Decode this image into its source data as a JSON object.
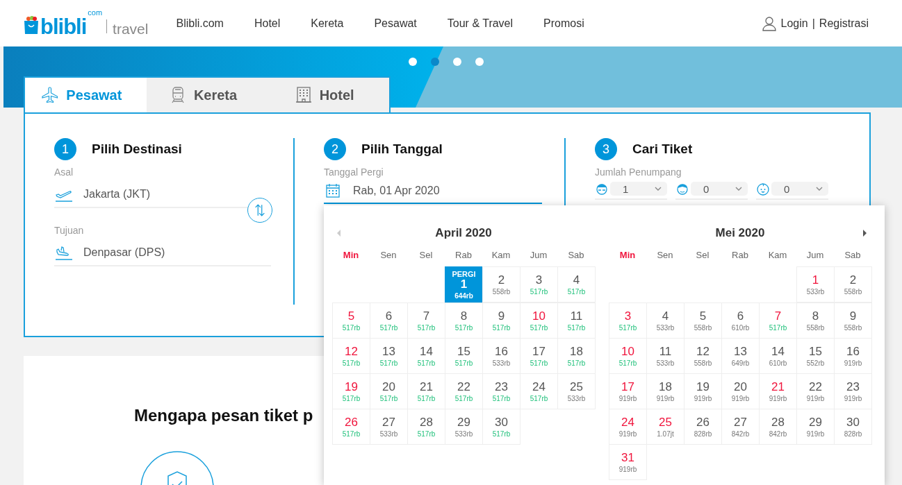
{
  "header": {
    "logo": {
      "name": "blibli",
      "suffix": "com",
      "product": "travel"
    },
    "nav": [
      {
        "label": "Blibli.com"
      },
      {
        "label": "Hotel"
      },
      {
        "label": "Kereta"
      },
      {
        "label": "Pesawat"
      },
      {
        "label": "Tour & Travel"
      },
      {
        "label": "Promosi"
      }
    ],
    "account": {
      "login": "Login",
      "separator": "|",
      "register": "Registrasi"
    }
  },
  "carousel": {
    "dots": [
      {
        "selected": false
      },
      {
        "selected": true
      },
      {
        "selected": false
      },
      {
        "selected": false
      }
    ]
  },
  "tabs": [
    {
      "kind": "plane",
      "label": "Pesawat",
      "selected": true
    },
    {
      "kind": "train",
      "label": "Kereta",
      "selected": false
    },
    {
      "kind": "hotel",
      "label": "Hotel",
      "selected": false
    }
  ],
  "steps": [
    {
      "number": "1",
      "title": "Pilih Destinasi",
      "origin": {
        "label": "Asal",
        "value": "Jakarta (JKT)"
      },
      "destination": {
        "label": "Tujuan",
        "value": "Denpasar (DPS)"
      }
    },
    {
      "number": "2",
      "title": "Pilih Tanggal",
      "date": {
        "label": "Tanggal Pergi",
        "value": "Rab, 01 Apr 2020"
      }
    },
    {
      "number": "3",
      "title": "Cari Tiket",
      "passengers": {
        "label": "Jumlah Penumpang",
        "counts": [
          {
            "kind": "adult",
            "value": "1"
          },
          {
            "kind": "child",
            "value": "0"
          },
          {
            "kind": "infant",
            "value": "0"
          }
        ]
      }
    }
  ],
  "calendar": {
    "prev": {
      "disabled": true
    },
    "next": {
      "disabled": false
    },
    "months": [
      {
        "title": "April 2020",
        "weekdays": [
          {
            "label": "Min",
            "holiday": true
          },
          {
            "label": "Sen",
            "holiday": false
          },
          {
            "label": "Sel",
            "holiday": false
          },
          {
            "label": "Rab",
            "holiday": false
          },
          {
            "label": "Kam",
            "holiday": false
          },
          {
            "label": "Jum",
            "holiday": false
          },
          {
            "label": "Sab",
            "holiday": false
          }
        ],
        "cells": [
          {
            "kind": "blank"
          },
          {
            "kind": "blank"
          },
          {
            "kind": "blank"
          },
          {
            "kind": "day",
            "day": "1",
            "price": "644rb",
            "holiday": false,
            "cheap": false,
            "selected": true,
            "tag": "PERGI"
          },
          {
            "kind": "day",
            "day": "2",
            "price": "558rb",
            "holiday": false,
            "cheap": false,
            "selected": false
          },
          {
            "kind": "day",
            "day": "3",
            "price": "517rb",
            "holiday": false,
            "cheap": true,
            "selected": false
          },
          {
            "kind": "day",
            "day": "4",
            "price": "517rb",
            "holiday": false,
            "cheap": true,
            "selected": false
          },
          {
            "kind": "day",
            "day": "5",
            "price": "517rb",
            "holiday": true,
            "cheap": true,
            "selected": false
          },
          {
            "kind": "day",
            "day": "6",
            "price": "517rb",
            "holiday": false,
            "cheap": true,
            "selected": false
          },
          {
            "kind": "day",
            "day": "7",
            "price": "517rb",
            "holiday": false,
            "cheap": true,
            "selected": false
          },
          {
            "kind": "day",
            "day": "8",
            "price": "517rb",
            "holiday": false,
            "cheap": true,
            "selected": false
          },
          {
            "kind": "day",
            "day": "9",
            "price": "517rb",
            "holiday": false,
            "cheap": true,
            "selected": false
          },
          {
            "kind": "day",
            "day": "10",
            "price": "517rb",
            "holiday": true,
            "cheap": true,
            "selected": false
          },
          {
            "kind": "day",
            "day": "11",
            "price": "517rb",
            "holiday": false,
            "cheap": true,
            "selected": false
          },
          {
            "kind": "day",
            "day": "12",
            "price": "517rb",
            "holiday": true,
            "cheap": true,
            "selected": false
          },
          {
            "kind": "day",
            "day": "13",
            "price": "517rb",
            "holiday": false,
            "cheap": true,
            "selected": false
          },
          {
            "kind": "day",
            "day": "14",
            "price": "517rb",
            "holiday": false,
            "cheap": true,
            "selected": false
          },
          {
            "kind": "day",
            "day": "15",
            "price": "517rb",
            "holiday": false,
            "cheap": true,
            "selected": false
          },
          {
            "kind": "day",
            "day": "16",
            "price": "533rb",
            "holiday": false,
            "cheap": false,
            "selected": false
          },
          {
            "kind": "day",
            "day": "17",
            "price": "517rb",
            "holiday": false,
            "cheap": true,
            "selected": false
          },
          {
            "kind": "day",
            "day": "18",
            "price": "517rb",
            "holiday": false,
            "cheap": true,
            "selected": false
          },
          {
            "kind": "day",
            "day": "19",
            "price": "517rb",
            "holiday": true,
            "cheap": true,
            "selected": false
          },
          {
            "kind": "day",
            "day": "20",
            "price": "517rb",
            "holiday": false,
            "cheap": true,
            "selected": false
          },
          {
            "kind": "day",
            "day": "21",
            "price": "517rb",
            "holiday": false,
            "cheap": true,
            "selected": false
          },
          {
            "kind": "day",
            "day": "22",
            "price": "517rb",
            "holiday": false,
            "cheap": true,
            "selected": false
          },
          {
            "kind": "day",
            "day": "23",
            "price": "517rb",
            "holiday": false,
            "cheap": true,
            "selected": false
          },
          {
            "kind": "day",
            "day": "24",
            "price": "517rb",
            "holiday": false,
            "cheap": true,
            "selected": false
          },
          {
            "kind": "day",
            "day": "25",
            "price": "533rb",
            "holiday": false,
            "cheap": false,
            "selected": false
          },
          {
            "kind": "day",
            "day": "26",
            "price": "517rb",
            "holiday": true,
            "cheap": true,
            "selected": false
          },
          {
            "kind": "day",
            "day": "27",
            "price": "533rb",
            "holiday": false,
            "cheap": false,
            "selected": false
          },
          {
            "kind": "day",
            "day": "28",
            "price": "517rb",
            "holiday": false,
            "cheap": true,
            "selected": false
          },
          {
            "kind": "day",
            "day": "29",
            "price": "533rb",
            "holiday": false,
            "cheap": false,
            "selected": false
          },
          {
            "kind": "day",
            "day": "30",
            "price": "517rb",
            "holiday": false,
            "cheap": true,
            "selected": false
          }
        ]
      },
      {
        "title": "Mei 2020",
        "weekdays": [
          {
            "label": "Min",
            "holiday": true
          },
          {
            "label": "Sen",
            "holiday": false
          },
          {
            "label": "Sel",
            "holiday": false
          },
          {
            "label": "Rab",
            "holiday": false
          },
          {
            "label": "Kam",
            "holiday": false
          },
          {
            "label": "Jum",
            "holiday": false
          },
          {
            "label": "Sab",
            "holiday": false
          }
        ],
        "cells": [
          {
            "kind": "blank"
          },
          {
            "kind": "blank"
          },
          {
            "kind": "blank"
          },
          {
            "kind": "blank"
          },
          {
            "kind": "blank"
          },
          {
            "kind": "day",
            "day": "1",
            "price": "533rb",
            "holiday": true,
            "cheap": false,
            "selected": false
          },
          {
            "kind": "day",
            "day": "2",
            "price": "558rb",
            "holiday": false,
            "cheap": false,
            "selected": false
          },
          {
            "kind": "day",
            "day": "3",
            "price": "517rb",
            "holiday": true,
            "cheap": true,
            "selected": false
          },
          {
            "kind": "day",
            "day": "4",
            "price": "533rb",
            "holiday": false,
            "cheap": false,
            "selected": false
          },
          {
            "kind": "day",
            "day": "5",
            "price": "558rb",
            "holiday": false,
            "cheap": false,
            "selected": false
          },
          {
            "kind": "day",
            "day": "6",
            "price": "610rb",
            "holiday": false,
            "cheap": false,
            "selected": false
          },
          {
            "kind": "day",
            "day": "7",
            "price": "517rb",
            "holiday": true,
            "cheap": true,
            "selected": false
          },
          {
            "kind": "day",
            "day": "8",
            "price": "558rb",
            "holiday": false,
            "cheap": false,
            "selected": false
          },
          {
            "kind": "day",
            "day": "9",
            "price": "558rb",
            "holiday": false,
            "cheap": false,
            "selected": false
          },
          {
            "kind": "day",
            "day": "10",
            "price": "517rb",
            "holiday": true,
            "cheap": true,
            "selected": false
          },
          {
            "kind": "day",
            "day": "11",
            "price": "533rb",
            "holiday": false,
            "cheap": false,
            "selected": false
          },
          {
            "kind": "day",
            "day": "12",
            "price": "558rb",
            "holiday": false,
            "cheap": false,
            "selected": false
          },
          {
            "kind": "day",
            "day": "13",
            "price": "649rb",
            "holiday": false,
            "cheap": false,
            "selected": false
          },
          {
            "kind": "day",
            "day": "14",
            "price": "610rb",
            "holiday": false,
            "cheap": false,
            "selected": false
          },
          {
            "kind": "day",
            "day": "15",
            "price": "552rb",
            "holiday": false,
            "cheap": false,
            "selected": false
          },
          {
            "kind": "day",
            "day": "16",
            "price": "919rb",
            "holiday": false,
            "cheap": false,
            "selected": false
          },
          {
            "kind": "day",
            "day": "17",
            "price": "919rb",
            "holiday": true,
            "cheap": false,
            "selected": false
          },
          {
            "kind": "day",
            "day": "18",
            "price": "919rb",
            "holiday": false,
            "cheap": false,
            "selected": false
          },
          {
            "kind": "day",
            "day": "19",
            "price": "919rb",
            "holiday": false,
            "cheap": false,
            "selected": false
          },
          {
            "kind": "day",
            "day": "20",
            "price": "919rb",
            "holiday": false,
            "cheap": false,
            "selected": false
          },
          {
            "kind": "day",
            "day": "21",
            "price": "919rb",
            "holiday": true,
            "cheap": false,
            "selected": false
          },
          {
            "kind": "day",
            "day": "22",
            "price": "919rb",
            "holiday": false,
            "cheap": false,
            "selected": false
          },
          {
            "kind": "day",
            "day": "23",
            "price": "919rb",
            "holiday": false,
            "cheap": false,
            "selected": false
          },
          {
            "kind": "day",
            "day": "24",
            "price": "919rb",
            "holiday": true,
            "cheap": false,
            "selected": false
          },
          {
            "kind": "day",
            "day": "25",
            "price": "1.07jt",
            "holiday": true,
            "cheap": false,
            "selected": false
          },
          {
            "kind": "day",
            "day": "26",
            "price": "828rb",
            "holiday": false,
            "cheap": false,
            "selected": false
          },
          {
            "kind": "day",
            "day": "27",
            "price": "842rb",
            "holiday": false,
            "cheap": false,
            "selected": false
          },
          {
            "kind": "day",
            "day": "28",
            "price": "842rb",
            "holiday": false,
            "cheap": false,
            "selected": false
          },
          {
            "kind": "day",
            "day": "29",
            "price": "919rb",
            "holiday": false,
            "cheap": false,
            "selected": false
          },
          {
            "kind": "day",
            "day": "30",
            "price": "828rb",
            "holiday": false,
            "cheap": false,
            "selected": false
          },
          {
            "kind": "day",
            "day": "31",
            "price": "919rb",
            "holiday": true,
            "cheap": false,
            "selected": false
          }
        ]
      }
    ]
  },
  "why_section": {
    "heading": "Mengapa pesan tiket p"
  }
}
